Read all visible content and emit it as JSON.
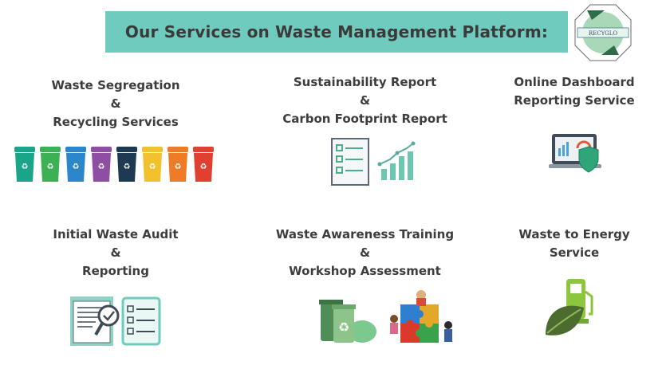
{
  "header": {
    "title": "Our Services on Waste Management Platform:",
    "logo_text": "RECYGLO"
  },
  "services": [
    {
      "line1": "Waste Segregation",
      "line2": "&",
      "line3": "Recycling Services",
      "icon": "recycling-bins-icon"
    },
    {
      "line1": "Sustainability Report",
      "line2": "&",
      "line3": "Carbon Footprint Report",
      "icon": "report-chart-icon"
    },
    {
      "line1": "Online Dashboard",
      "line2": "Reporting Service",
      "icon": "dashboard-laptop-icon"
    },
    {
      "line1": "Initial Waste Audit",
      "line2": "&",
      "line3": "Reporting",
      "icon": "audit-checklist-icon"
    },
    {
      "line1": "Waste Awareness Training",
      "line2": "&",
      "line3": "Workshop Assessment",
      "icon": "training-puzzle-icon"
    },
    {
      "line1": "Waste to Energy",
      "line2": "Service",
      "icon": "energy-leaf-icon"
    }
  ],
  "colors": {
    "banner": "#6fcbbd",
    "text": "#3d3d3d",
    "bins": [
      "#1aa58b",
      "#3cb054",
      "#2b87c9",
      "#8e4fa3",
      "#1d3a52",
      "#f2c12e",
      "#ee7b26",
      "#e0402f"
    ]
  }
}
